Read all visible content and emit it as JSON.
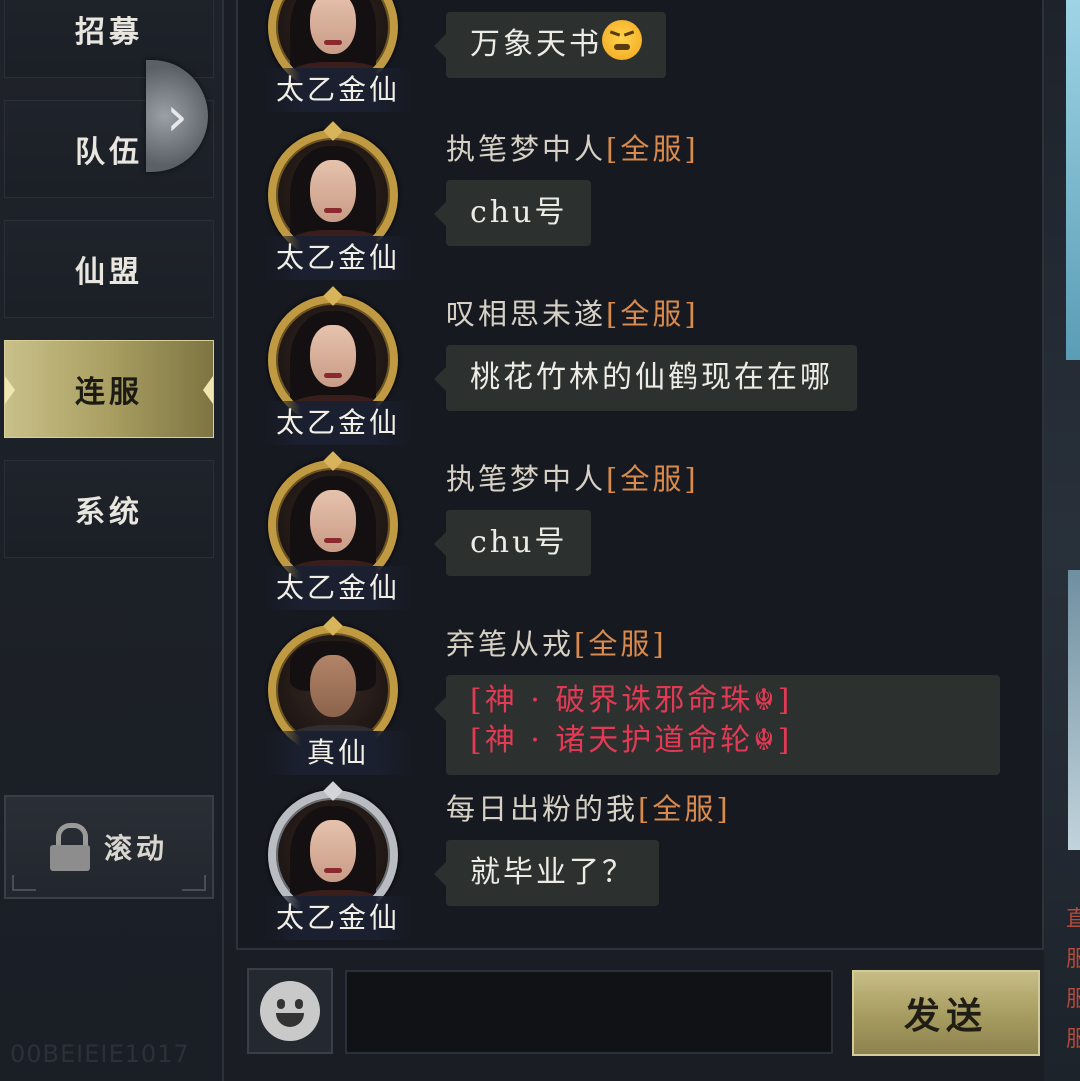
{
  "sidebar": {
    "tabs": [
      {
        "label": "招募",
        "active": false
      },
      {
        "label": "队伍",
        "active": false
      },
      {
        "label": "仙盟",
        "active": false
      },
      {
        "label": "连服",
        "active": true
      },
      {
        "label": "系统",
        "active": false
      }
    ],
    "expand_icon": "chevron-right-icon",
    "scroll_button": {
      "label": "滚动",
      "icon": "lock-icon"
    },
    "watermark": "00BEIEIE1017"
  },
  "chat": {
    "messages": [
      {
        "sender": "",
        "tag": "",
        "rank": "太乙金仙",
        "ring": "gold",
        "text": "万象天书",
        "emoji": "huffing-face-emoji"
      },
      {
        "sender": "执笔梦中人",
        "tag": "[全服]",
        "rank": "太乙金仙",
        "ring": "gold",
        "text": "chu号"
      },
      {
        "sender": "叹相思未遂",
        "tag": "[全服]",
        "rank": "太乙金仙",
        "ring": "gold",
        "text": "桃花竹林的仙鹤现在在哪"
      },
      {
        "sender": "执笔梦中人",
        "tag": "[全服]",
        "rank": "太乙金仙",
        "ring": "gold",
        "text": "chu号"
      },
      {
        "sender": "弃笔从戎",
        "tag": "[全服]",
        "rank": "真仙",
        "ring": "gold",
        "lines": [
          "[神 · 破界诛邪命珠☬]",
          "[神 · 诸天护道命轮☬]"
        ]
      },
      {
        "sender": "每日出粉的我",
        "tag": "[全服]",
        "rank": "太乙金仙",
        "ring": "silver",
        "text": "就毕业了？"
      }
    ]
  },
  "input": {
    "value": "",
    "placeholder": "",
    "send_label": "发送",
    "emoji_icon": "smiley-face-icon"
  },
  "colors": {
    "accent_gold": "#c09a42",
    "server_tag": "#d98a4c",
    "item_red": "#e23a54",
    "panel_bg": "#161920"
  },
  "right_edge_text": [
    "直",
    "服",
    "服",
    "服"
  ]
}
